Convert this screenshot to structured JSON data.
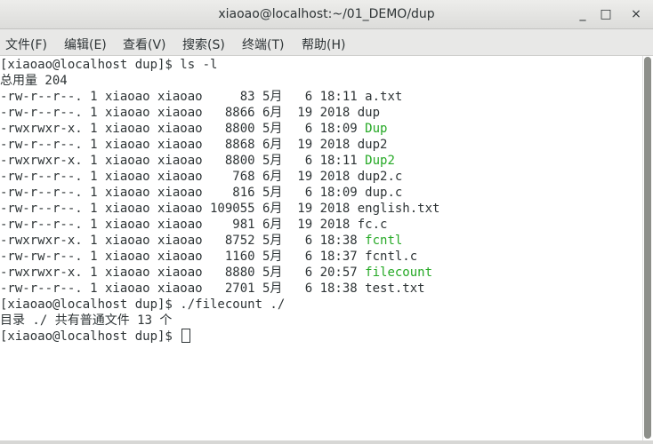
{
  "window": {
    "title": "xiaoao@localhost:~/01_DEMO/dup"
  },
  "window_controls": {
    "minimize": "_",
    "maximize": "□",
    "close": "×"
  },
  "menu": [
    "文件(F)",
    "编辑(E)",
    "查看(V)",
    "搜索(S)",
    "终端(T)",
    "帮助(H)"
  ],
  "terminal": {
    "prompt1": "[xiaoao@localhost dup]$ ls -l",
    "total": "总用量 204",
    "entries": [
      {
        "prefix": "-rw-r--r--. 1 xiaoao xiaoao     83 5月   6 18:11 ",
        "name": "a.txt",
        "exec": false
      },
      {
        "prefix": "-rw-r--r--. 1 xiaoao xiaoao   8866 6月  19 2018 ",
        "name": "dup",
        "exec": false
      },
      {
        "prefix": "-rwxrwxr-x. 1 xiaoao xiaoao   8800 5月   6 18:09 ",
        "name": "Dup",
        "exec": true
      },
      {
        "prefix": "-rw-r--r--. 1 xiaoao xiaoao   8868 6月  19 2018 ",
        "name": "dup2",
        "exec": false
      },
      {
        "prefix": "-rwxrwxr-x. 1 xiaoao xiaoao   8800 5月   6 18:11 ",
        "name": "Dup2",
        "exec": true
      },
      {
        "prefix": "-rw-r--r--. 1 xiaoao xiaoao    768 6月  19 2018 ",
        "name": "dup2.c",
        "exec": false
      },
      {
        "prefix": "-rw-r--r--. 1 xiaoao xiaoao    816 5月   6 18:09 ",
        "name": "dup.c",
        "exec": false
      },
      {
        "prefix": "-rw-r--r--. 1 xiaoao xiaoao 109055 6月  19 2018 ",
        "name": "english.txt",
        "exec": false
      },
      {
        "prefix": "-rw-r--r--. 1 xiaoao xiaoao    981 6月  19 2018 ",
        "name": "fc.c",
        "exec": false
      },
      {
        "prefix": "-rwxrwxr-x. 1 xiaoao xiaoao   8752 5月   6 18:38 ",
        "name": "fcntl",
        "exec": true
      },
      {
        "prefix": "-rw-rw-r--. 1 xiaoao xiaoao   1160 5月   6 18:37 ",
        "name": "fcntl.c",
        "exec": false
      },
      {
        "prefix": "-rwxrwxr-x. 1 xiaoao xiaoao   8880 5月   6 20:57 ",
        "name": "filecount",
        "exec": true
      },
      {
        "prefix": "-rw-r--r--. 1 xiaoao xiaoao   2701 5月   6 18:38 ",
        "name": "test.txt",
        "exec": false
      }
    ],
    "prompt2": "[xiaoao@localhost dup]$ ./filecount ./",
    "output": "目录 ./ 共有普通文件 13 个",
    "prompt3": "[xiaoao@localhost dup]$ "
  },
  "colors": {
    "exec_file": "#26a926",
    "text": "#2e3436",
    "background": "#ffffff"
  }
}
